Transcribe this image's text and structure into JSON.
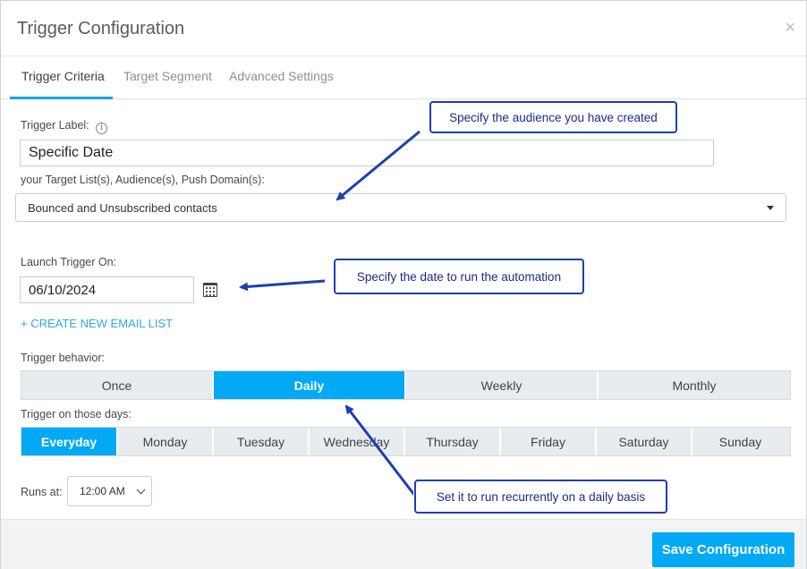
{
  "dialog": {
    "title": "Trigger Configuration",
    "close_glyph": "×"
  },
  "tabs": [
    {
      "label": "Trigger Criteria",
      "active": true
    },
    {
      "label": "Target Segment",
      "active": false
    },
    {
      "label": "Advanced Settings",
      "active": false
    }
  ],
  "form": {
    "trigger_label": {
      "label": "Trigger Label:",
      "info_glyph": "i",
      "value": "Specific Date"
    },
    "target_list": {
      "label": "your Target List(s), Audience(s), Push Domain(s):",
      "selected": "Bounced and Unsubscribed contacts"
    },
    "launch_on": {
      "label": "Launch Trigger On:",
      "value": "06/10/2024"
    },
    "create_link": "+ CREATE NEW EMAIL LIST",
    "behavior": {
      "label": "Trigger behavior:",
      "options": [
        "Once",
        "Daily",
        "Weekly",
        "Monthly"
      ],
      "selected": "Daily"
    },
    "days": {
      "label": "Trigger on those days:",
      "options": [
        "Everyday",
        "Monday",
        "Tuesday",
        "Wednesday",
        "Thursday",
        "Friday",
        "Saturday",
        "Sunday"
      ],
      "selected": "Everyday"
    },
    "runs_at": {
      "label": "Runs at:",
      "value": "12:00 AM"
    }
  },
  "footer": {
    "save_label": "Save Configuration"
  },
  "annotations": {
    "audience": "Specify the audience you have created",
    "date": "Specify the date to run the automation",
    "daily": "Set it to run recurrently on a daily basis"
  },
  "colors": {
    "accent": "#03a9f4",
    "link": "#33a5e8",
    "annotation": "#1f3fae"
  },
  "icons": [
    "info-icon",
    "calendar-icon",
    "close-icon",
    "chevron-down-icon"
  ]
}
